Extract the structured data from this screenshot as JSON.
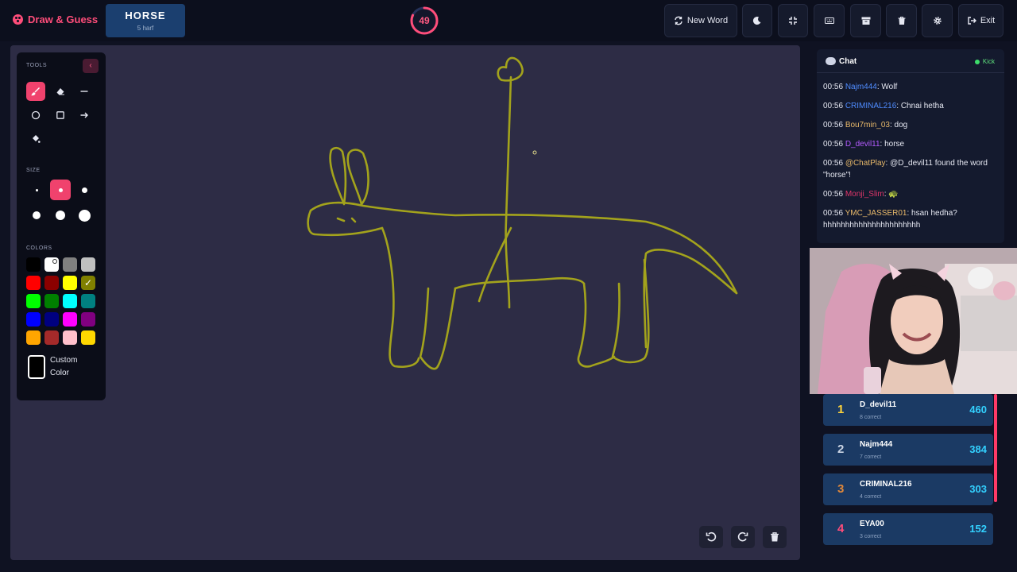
{
  "app": {
    "title": "Draw & Guess"
  },
  "word": {
    "text": "HORSE",
    "hint": "5 harf"
  },
  "timer": {
    "value": "49",
    "remaining_fraction": 0.82,
    "color": "#ff4d7a"
  },
  "toolbar": {
    "new_word_label": "New Word",
    "exit_label": "Exit",
    "icons": [
      "moon-icon",
      "fullscreen-exit-icon",
      "keyboard-icon",
      "archive-icon",
      "trash-icon",
      "gear-icon"
    ]
  },
  "tools_panel": {
    "tools_label": "TOOLS",
    "size_label": "SIZE",
    "colors_label": "COLORS",
    "custom_color_label": "Custom Color",
    "tools": [
      "brush",
      "eraser",
      "line",
      "circle",
      "rectangle",
      "arrow",
      "fill"
    ],
    "active_tool": "brush",
    "active_size": "medium",
    "colors": [
      "#000000",
      "#ffffff",
      "#808080",
      "#c0c0c0",
      "#ff0000",
      "#8b0000",
      "#ffff00",
      "#808000",
      "#00ff00",
      "#008000",
      "#00ffff",
      "#008080",
      "#0000ff",
      "#000080",
      "#ff00ff",
      "#800080",
      "#ffa500",
      "#a52a2a",
      "#ffc0cb",
      "#ffd700"
    ],
    "selected_color": "#808000",
    "brush_color": "#a3a31c"
  },
  "chat": {
    "title": "Chat",
    "status": "Kick",
    "messages": [
      {
        "time": "00:56",
        "user": "Najm444",
        "user_color": "#4f8cff",
        "text": ": Wolf"
      },
      {
        "time": "00:56",
        "user": "CRIMINAL216",
        "user_color": "#4f8cff",
        "text": ": Chnai hetha"
      },
      {
        "time": "00:56",
        "user": "Bou7min_03",
        "user_color": "#e8b96a",
        "text": ": dog"
      },
      {
        "time": "00:56",
        "user": "D_devil11",
        "user_color": "#b45cff",
        "text": ": horse"
      },
      {
        "time": "00:56",
        "user": "@ChatPlay",
        "user_color": "#e8b96a",
        "text": ": @D_devil11 found the word \"horse\"!"
      },
      {
        "time": "00:56",
        "user": "Monji_Slim",
        "user_color": "#e0356a",
        "text": ":  🐢"
      },
      {
        "time": "00:56",
        "user": "YMC_JASSER01",
        "user_color": "#e8b96a",
        "text": ": hsan hedha? hhhhhhhhhhhhhhhhhhhhhh"
      }
    ]
  },
  "leaderboard": [
    {
      "rank": "1",
      "name": "D_devil11",
      "correct": "8 correct",
      "points": "460",
      "rank_color": "#ffd43b"
    },
    {
      "rank": "2",
      "name": "Najm444",
      "correct": "7 correct",
      "points": "384",
      "rank_color": "#c9d3e3"
    },
    {
      "rank": "3",
      "name": "CRIMINAL216",
      "correct": "4 correct",
      "points": "303",
      "rank_color": "#e0883a"
    },
    {
      "rank": "4",
      "name": "EYA00",
      "correct": "3 correct",
      "points": "152",
      "rank_color": "#ff4d7a"
    }
  ]
}
